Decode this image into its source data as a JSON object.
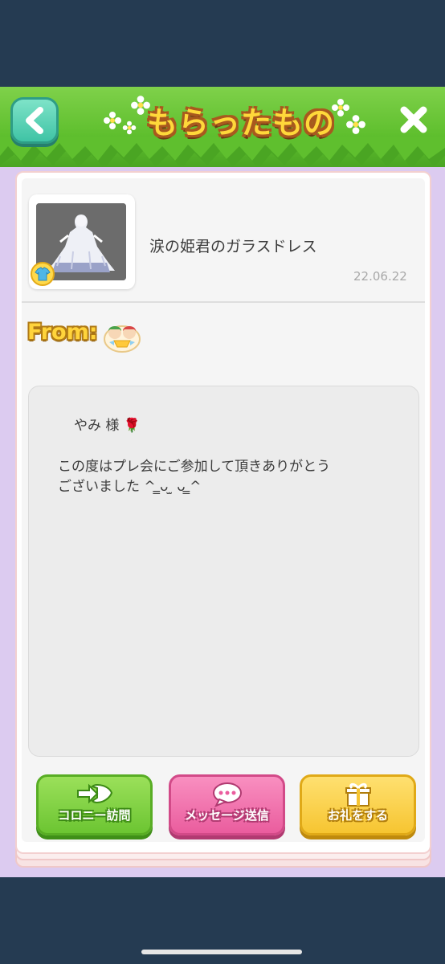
{
  "header": {
    "title": "もらったもの",
    "back_icon": "chevron-left-icon",
    "close_icon": "close-icon"
  },
  "item": {
    "name": "涙の姫君のガラスドレス",
    "date": "22.06.22",
    "category_icon": "shirt-icon"
  },
  "sender": {
    "from_label": "From:",
    "avatar_icon": "twin-characters-avatar"
  },
  "message": {
    "line1": "やみ 様 🌹",
    "line2": "この度はプレ会にご参加して頂きありがとう",
    "line3": "ございました ^ ̳ᴗ ̫ ᴗ ̳^"
  },
  "actions": {
    "colony_label": "コロニー訪問",
    "message_label": "メッセージ送信",
    "thanks_label": "お礼をする"
  },
  "colors": {
    "header_green": "#5fbf2e",
    "panel_lavender": "#dccbf0",
    "colony_green": "#6cc532",
    "message_pink": "#ea5d9e",
    "thanks_yellow": "#f6c531"
  }
}
